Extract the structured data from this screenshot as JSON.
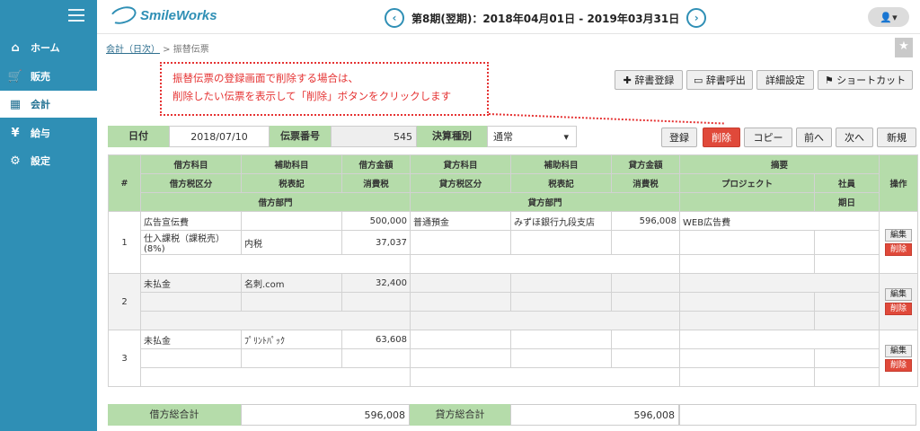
{
  "app": {
    "logo": "SmileWorks",
    "period": "第8期(翌期)：2018年04月01日 - 2019年03月31日",
    "prev": "‹",
    "next": "›",
    "user_icon": "👤▾"
  },
  "sidebar": {
    "items": [
      {
        "label": "ホーム",
        "icon": "home-icon",
        "glyph": "⌂"
      },
      {
        "label": "販売",
        "icon": "cart-icon",
        "glyph": "🛒"
      },
      {
        "label": "会計",
        "icon": "calculator-icon",
        "glyph": "▦"
      },
      {
        "label": "給与",
        "icon": "money-bag-icon",
        "glyph": "¥"
      },
      {
        "label": "設定",
        "icon": "gear-icon",
        "glyph": "⚙"
      }
    ]
  },
  "breadcrumb": {
    "link": "会計（日次）",
    "sep": " > ",
    "current": "振替伝票"
  },
  "callout": {
    "line1": "振替伝票の登録画面で削除する場合は、",
    "line2": "削除したい伝票を表示して「削除」ボタンをクリックします"
  },
  "toolbar": {
    "dict_register": "✚ 辞書登録",
    "dict_call": "▭ 辞書呼出",
    "detail": "詳細設定",
    "shortcut": "⚑ ショートカット"
  },
  "header": {
    "date_label": "日付",
    "date": "2018/07/10",
    "no_label": "伝票番号",
    "no": "545",
    "type_label": "決算種別",
    "type": "通常",
    "type_caret": "▾"
  },
  "actions": {
    "register": "登録",
    "delete": "削除",
    "copy": "コピー",
    "prev": "前へ",
    "next": "次へ",
    "new": "新規"
  },
  "cols": {
    "num": "#",
    "debit_acct": "借方科目",
    "debit_sub": "補助科目",
    "debit_amt": "借方金額",
    "credit_acct": "貸方科目",
    "credit_sub": "補助科目",
    "credit_amt": "貸方金額",
    "summary": "摘要",
    "op": "操作",
    "debit_tax_cls": "借方税区分",
    "tax_note1": "税表記",
    "tax1": "消費税",
    "credit_tax_cls": "貸方税区分",
    "tax_note2": "税表記",
    "tax2": "消費税",
    "project": "プロジェクト",
    "staff": "社員",
    "debit_dept": "借方部門",
    "credit_dept": "貸方部門",
    "due": "期日"
  },
  "rows": [
    {
      "no": "1",
      "d_acct": "広告宣伝費",
      "d_sub": "",
      "d_amt": "500,000",
      "c_acct": "普通預金",
      "c_sub": "みずほ銀行九段支店",
      "c_amt": "596,008",
      "summary": "WEB広告費",
      "d_tax": "仕入課税（課税売）(8%)",
      "d_taxnote": "内税",
      "d_taxamt": "37,037"
    },
    {
      "no": "2",
      "d_acct": "未払金",
      "d_sub": "名刺.com",
      "d_amt": "32,400",
      "c_acct": "",
      "c_sub": "",
      "c_amt": "",
      "summary": "",
      "d_tax": "",
      "d_taxnote": "",
      "d_taxamt": ""
    },
    {
      "no": "3",
      "d_acct": "未払金",
      "d_sub": "ﾌﾟﾘﾝﾄﾊﾟｯｸ",
      "d_amt": "63,608",
      "c_acct": "",
      "c_sub": "",
      "c_amt": "",
      "summary": "",
      "d_tax": "",
      "d_taxnote": "",
      "d_taxamt": ""
    }
  ],
  "row_buttons": {
    "edit": "編集",
    "delete": "削除"
  },
  "totals": {
    "debit_label": "借方総合計",
    "debit": "596,008",
    "credit_label": "貸方総合計",
    "credit": "596,008"
  }
}
